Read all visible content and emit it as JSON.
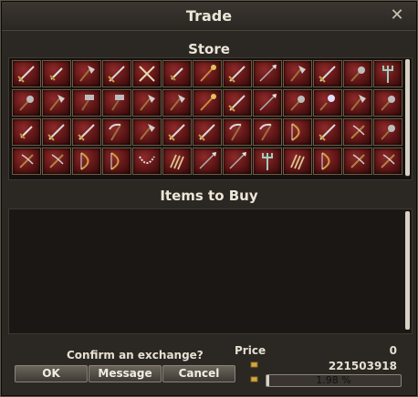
{
  "window": {
    "title": "Trade",
    "close_icon": "close-icon"
  },
  "store": {
    "title": "Store",
    "rows": 4,
    "cols": 13,
    "item_icons": [
      "sword",
      "dagger",
      "axe",
      "sword",
      "cross-sword",
      "dagger",
      "staff",
      "sword",
      "spear",
      "axe",
      "sword",
      "mace",
      "trident",
      "mace",
      "axe",
      "hammer",
      "hammer",
      "axe",
      "axe",
      "staff",
      "sword",
      "spear",
      "mace",
      "flail",
      "axe",
      "mace",
      "dagger",
      "sword",
      "sword",
      "scythe",
      "axe",
      "sword",
      "sword",
      "scythe",
      "scythe",
      "bow",
      "sword",
      "crossbow",
      "mace",
      "crossbow",
      "crossbow",
      "bow",
      "bow",
      "chain-whip",
      "claw",
      "spear",
      "spear",
      "trident",
      "claw",
      "bow",
      "crossbow",
      "crossbow"
    ]
  },
  "buy": {
    "title": "Items to Buy"
  },
  "footer": {
    "confirm_text": "Confirm an exchange?",
    "ok_label": "OK",
    "message_label": "Message",
    "cancel_label": "Cancel",
    "price_label": "Price",
    "price_value": "0",
    "money_value": "221503918",
    "progress_text": "1.98 %",
    "progress_fraction": 0.0198
  },
  "colors": {
    "slot_red": "#8e2a2a",
    "accent_gold": "#d4a640"
  }
}
